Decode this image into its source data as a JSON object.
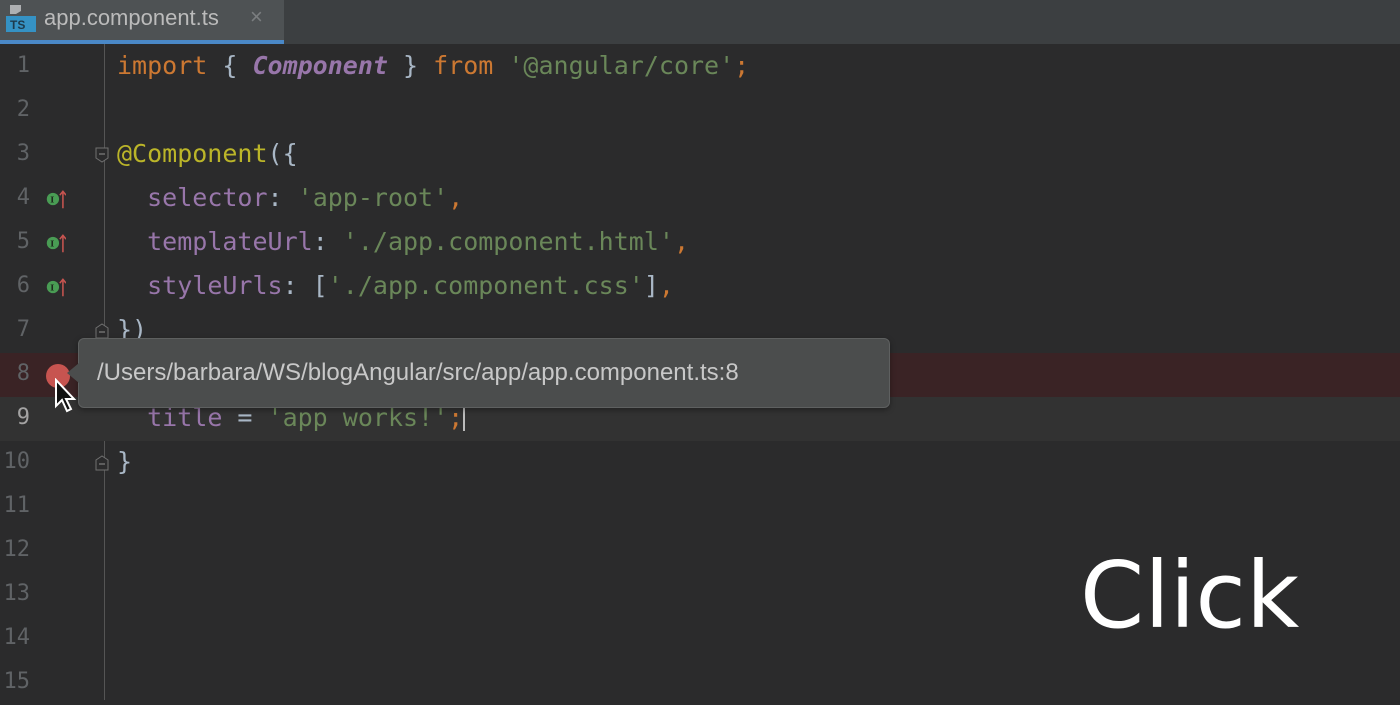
{
  "tab": {
    "filename": "app.component.ts",
    "icon": "typescript-file-icon",
    "close": "×",
    "file_icon_text": "TS"
  },
  "lines": [
    {
      "n": "1"
    },
    {
      "n": "2"
    },
    {
      "n": "3"
    },
    {
      "n": "4"
    },
    {
      "n": "5"
    },
    {
      "n": "6"
    },
    {
      "n": "7"
    },
    {
      "n": "8"
    },
    {
      "n": "9"
    },
    {
      "n": "10"
    },
    {
      "n": "11"
    },
    {
      "n": "12"
    },
    {
      "n": "13"
    },
    {
      "n": "14"
    },
    {
      "n": "15"
    }
  ],
  "code": {
    "l1": {
      "import": "import",
      "open": " { ",
      "component": "Component",
      "close": " } ",
      "from": "from",
      "sp": " ",
      "module": "'@angular/core'",
      "semi": ";"
    },
    "l3": {
      "decorator": "@Component",
      "rest": "({"
    },
    "l4": {
      "indent": "  ",
      "key": "selector",
      "colon": ": ",
      "value": "'app-root'",
      "comma": ","
    },
    "l5": {
      "indent": "  ",
      "key": "templateUrl",
      "colon": ": ",
      "value": "'./app.component.html'",
      "comma": ","
    },
    "l6": {
      "indent": "  ",
      "key": "styleUrls",
      "colon": ": [",
      "value": "'./app.component.css'",
      "close": "]",
      "comma": ","
    },
    "l7": {
      "text": "})"
    },
    "l9": {
      "indent": "  ",
      "key": "title",
      "eq": " = ",
      "value": "'app works!'",
      "semi": ";"
    },
    "l10": {
      "text": "}"
    }
  },
  "tooltip": {
    "text": "/Users/barbara/WS/blogAngular/src/app/app.component.ts:8"
  },
  "overlay": {
    "text": "Click"
  },
  "colors": {
    "background": "#2b2b2c",
    "keyword": "#cc7832",
    "property": "#9876aa",
    "string": "#6a8759",
    "annotation": "#bbb529",
    "breakpoint": "#c75450",
    "tab_accent": "#4a88c7"
  }
}
